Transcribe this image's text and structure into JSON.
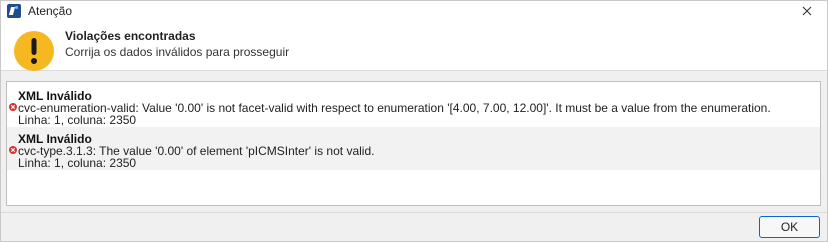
{
  "window": {
    "title": "Atenção"
  },
  "header": {
    "title": "Violações encontradas",
    "subtitle": "Corrija os dados inválidos para prosseguir"
  },
  "errors": [
    {
      "title": "XML Inválido",
      "message": "cvc-enumeration-valid: Value '0.00' is not facet-valid with respect to enumeration '[4.00, 7.00, 12.00]'. It must be a value from the enumeration.",
      "location": "Linha: 1, coluna: 2350"
    },
    {
      "title": "XML Inválido",
      "message": "cvc-type.3.1.3: The value '0.00' of element 'pICMSInter' is not valid.",
      "location": "Linha: 1, coluna: 2350"
    }
  ],
  "footer": {
    "ok_label": "OK"
  },
  "colors": {
    "warning": "#f6b820",
    "error": "#d9342b",
    "accent": "#0a64d6"
  }
}
